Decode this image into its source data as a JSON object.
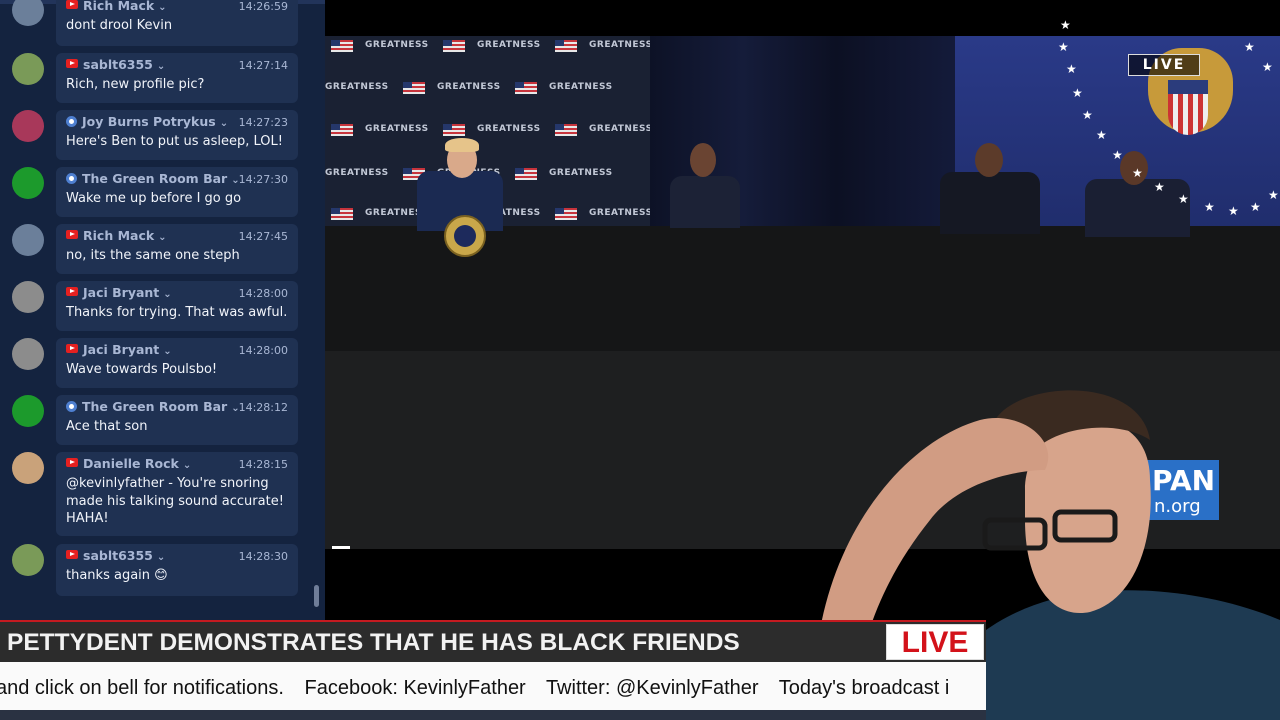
{
  "chat": {
    "messages": [
      {
        "user": "Rich Mack",
        "source": "youtube",
        "time": "14:26:59",
        "text": "dont drool Kevin",
        "avatar": "#6b7f9a"
      },
      {
        "user": "sablt6355",
        "source": "youtube",
        "time": "14:27:14",
        "text": "Rich, new profile pic?",
        "avatar": "#7a9a58"
      },
      {
        "user": "Joy Burns Potrykus",
        "source": "web",
        "time": "14:27:23",
        "text": "Here's Ben to put us asleep, LOL!",
        "avatar": "#a8385a"
      },
      {
        "user": "The Green Room Bar",
        "source": "web",
        "time": "14:27:30",
        "text": "Wake me up before I go go",
        "avatar": "#1c9a2c"
      },
      {
        "user": "Rich Mack",
        "source": "youtube",
        "time": "14:27:45",
        "text": "no, its the same one steph",
        "avatar": "#6b7f9a"
      },
      {
        "user": "Jaci Bryant",
        "source": "youtube",
        "time": "14:28:00",
        "text": "Thanks for trying. That was awful.",
        "avatar": "#8c8c8c"
      },
      {
        "user": "Jaci Bryant",
        "source": "youtube",
        "time": "14:28:00",
        "text": "Wave towards Poulsbo!",
        "avatar": "#8c8c8c"
      },
      {
        "user": "The Green Room Bar",
        "source": "web",
        "time": "14:28:12",
        "text": "Ace that son",
        "avatar": "#1c9a2c"
      },
      {
        "user": "Danielle Rock",
        "source": "youtube",
        "time": "14:28:15",
        "text": "@kevinlyfather - You're snoring made his talking sound accurate! HAHA!",
        "avatar": "#c9a27a"
      },
      {
        "user": "sablt6355",
        "source": "youtube",
        "time": "14:28:30",
        "text": "thanks again 😊",
        "avatar": "#7a9a58"
      }
    ]
  },
  "video": {
    "live_bug": "LIVE",
    "network_logo_top": "PAN",
    "network_logo_bottom": "n.org",
    "backdrop_text": "GREATNESS"
  },
  "lower_third": {
    "headline": "PETTYDENT DEMONSTRATES THAT HE HAS BLACK FRIENDS",
    "live_label": "LIVE",
    "ticker": [
      "and click on bell for notifications.",
      "Facebook: KevinlyFather",
      "Twitter: @KevinlyFather",
      "Today's broadcast i"
    ]
  },
  "colors": {
    "chat_bg": "#14233f",
    "bubble_bg": "#1f3152",
    "live_red": "#d3121a",
    "youtube_red": "#e52020"
  }
}
